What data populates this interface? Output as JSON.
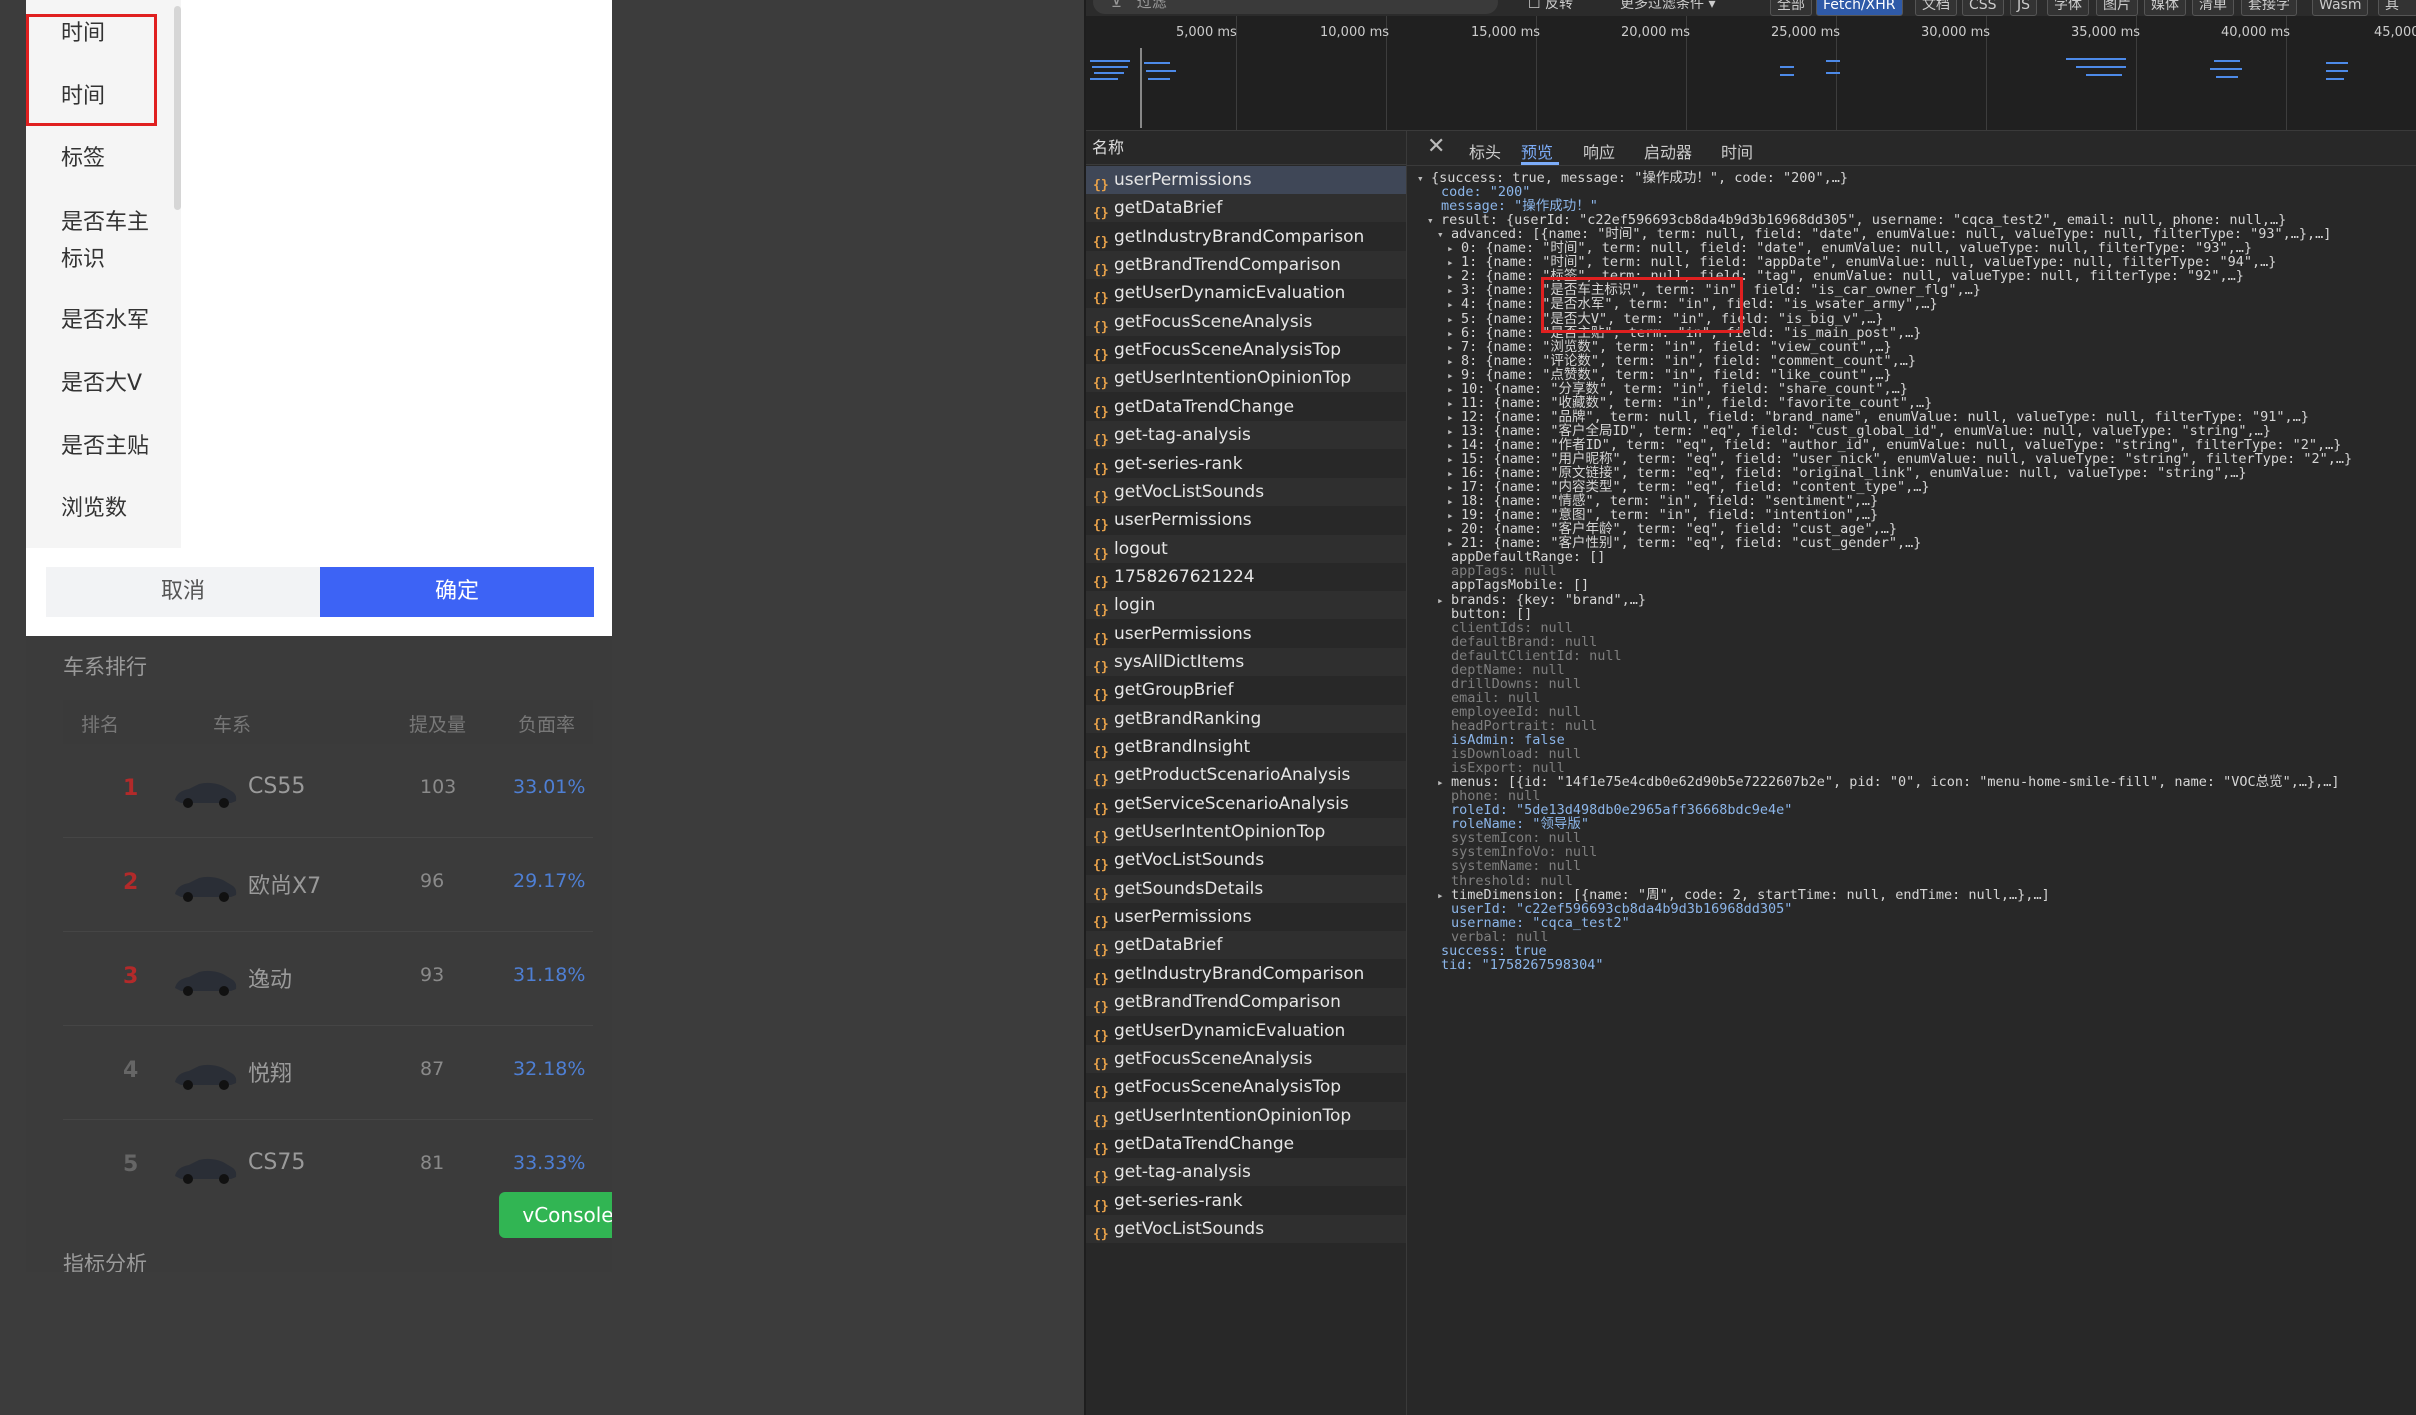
{
  "mobile": {
    "side_items": [
      "时间",
      "时间",
      "标签",
      "是否车主标识",
      "是否水军",
      "是否大V",
      "是否主贴",
      "浏览数"
    ],
    "cancel": "取消",
    "confirm": "确定",
    "rank_title": "车系排行",
    "rank_headers": [
      "排名",
      "车系",
      "提及量",
      "负面率"
    ],
    "rank_rows": [
      {
        "rank": "1",
        "name": "CS55",
        "count": "103",
        "rate": "33.01%"
      },
      {
        "rank": "2",
        "name": "欧尚X7",
        "count": "96",
        "rate": "29.17%"
      },
      {
        "rank": "3",
        "name": "逸动",
        "count": "93",
        "rate": "31.18%"
      },
      {
        "rank": "4",
        "name": "悦翔",
        "count": "87",
        "rate": "32.18%"
      },
      {
        "rank": "5",
        "name": "CS75",
        "count": "81",
        "rate": "33.33%"
      }
    ],
    "vconsole": "vConsole",
    "metric_title": "指标分析"
  },
  "devtools": {
    "filter_placeholder": "过滤",
    "filter_chips": [
      "反转",
      "更多过滤条件",
      "全部",
      "Fetch/XHR",
      "文档",
      "CSS",
      "JS",
      "字体",
      "图片",
      "媒体",
      "清单",
      "套接字",
      "Wasm",
      "其他"
    ],
    "timeline_labels": [
      "5,000 ms",
      "10,000 ms",
      "15,000 ms",
      "20,000 ms",
      "25,000 ms",
      "30,000 ms",
      "35,000 ms",
      "40,000 ms",
      "45,000"
    ],
    "name_header": "名称",
    "requests": [
      "userPermissions",
      "getDataBrief",
      "getIndustryBrandComparison",
      "getBrandTrendComparison",
      "getUserDynamicEvaluation",
      "getFocusSceneAnalysis",
      "getFocusSceneAnalysisTop",
      "getUserIntentionOpinionTop",
      "getDataTrendChange",
      "get-tag-analysis",
      "get-series-rank",
      "getVocListSounds",
      "userPermissions",
      "logout",
      "1758267621224",
      "login",
      "userPermissions",
      "sysAllDictItems",
      "getGroupBrief",
      "getBrandRanking",
      "getBrandInsight",
      "getProductScenarioAnalysis",
      "getServiceScenarioAnalysis",
      "getUserIntentOpinionTop",
      "getVocListSounds",
      "getSoundsDetails",
      "userPermissions",
      "getDataBrief",
      "getIndustryBrandComparison",
      "getBrandTrendComparison",
      "getUserDynamicEvaluation",
      "getFocusSceneAnalysis",
      "getFocusSceneAnalysisTop",
      "getUserIntentionOpinionTop",
      "getDataTrendChange",
      "get-tag-analysis",
      "get-series-rank",
      "getVocListSounds"
    ],
    "tabs": [
      "标头",
      "预览",
      "响应",
      "启动器",
      "时间"
    ],
    "close": "✕",
    "json_lines": [
      "{success: true, message: \"操作成功！\", code: \"200\",…}",
      "code: \"200\"",
      "message: \"操作成功！\"",
      "result: {userId: \"c22ef596693cb8da4b9d3b16968dd305\", username: \"cqca_test2\", email: null, phone: null,…}",
      "advanced: [{name: \"时间\", term: null, field: \"date\", enumValue: null, valueType: null, filterType: \"93\",…},…]",
      "0: {name: \"时间\", term: null, field: \"date\", enumValue: null, valueType: null, filterType: \"93\",…}",
      "1: {name: \"时间\", term: null, field: \"appDate\", enumValue: null, valueType: null, filterType: \"94\",…}",
      "2: {name: \"标签\", term: null, field: \"tag\", enumValue: null, valueType: null, filterType: \"92\",…}",
      "3: {name: \"是否车主标识\", term: \"in\", field: \"is_car_owner_flg\",…}",
      "4: {name: \"是否水军\", term: \"in\", field: \"is_wsater_army\",…}",
      "5: {name: \"是否大V\", term: \"in\", field: \"is_big_v\",…}",
      "6: {name: \"是否主贴\", term: \"in\", field: \"is_main_post\",…}",
      "7: {name: \"浏览数\", term: \"in\", field: \"view_count\",…}",
      "8: {name: \"评论数\", term: \"in\", field: \"comment_count\",…}",
      "9: {name: \"点赞数\", term: \"in\", field: \"like_count\",…}",
      "10: {name: \"分享数\", term: \"in\", field: \"share_count\",…}",
      "11: {name: \"收藏数\", term: \"in\", field: \"favorite_count\",…}",
      "12: {name: \"品牌\", term: null, field: \"brand_name\", enumValue: null, valueType: null, filterType: \"91\",…}",
      "13: {name: \"客户全局ID\", term: \"eq\", field: \"cust_global_id\", enumValue: null, valueType: \"string\",…}",
      "14: {name: \"作者ID\", term: \"eq\", field: \"author_id\", enumValue: null, valueType: \"string\", filterType: \"2\",…}",
      "15: {name: \"用户昵称\", term: \"eq\", field: \"user_nick\", enumValue: null, valueType: \"string\", filterType: \"2\",…}",
      "16: {name: \"原文链接\", term: \"eq\", field: \"original_link\", enumValue: null, valueType: \"string\",…}",
      "17: {name: \"内容类型\", term: \"eq\", field: \"content_type\",…}",
      "18: {name: \"情感\", term: \"in\", field: \"sentiment\",…}",
      "19: {name: \"意图\", term: \"in\", field: \"intention\",…}",
      "20: {name: \"客户年龄\", term: \"eq\", field: \"cust_age\",…}",
      "21: {name: \"客户性别\", term: \"eq\", field: \"cust_gender\",…}",
      "appDefaultRange: []",
      "appTags: null",
      "appTagsMobile: []",
      "brands: {key: \"brand\",…}",
      "button: []",
      "clientIds: null",
      "defaultBrand: null",
      "defaultClientId: null",
      "deptName: null",
      "drillDowns: null",
      "email: null",
      "employeeId: null",
      "headPortrait: null",
      "isAdmin: false",
      "isDownload: null",
      "isExport: null",
      "menus: [{id: \"14f1e75e4cdb0e62d90b5e7222607b2e\", pid: \"0\", icon: \"menu-home-smile-fill\", name: \"VOC总览\",…},…]",
      "phone: null",
      "roleId: \"5de13d498db0e2965aff36668bdc9e4e\"",
      "roleName: \"领导版\"",
      "systemIcon: null",
      "systemInfoVo: null",
      "systemName: null",
      "threshold: null",
      "timeDimension: [{name: \"周\", code: 2, startTime: null, endTime: null,…},…]",
      "userId: \"c22ef596693cb8da4b9d3b16968dd305\"",
      "username: \"cqca_test2\"",
      "verbal: null",
      "success: true",
      "tid: \"1758267598304\""
    ]
  }
}
